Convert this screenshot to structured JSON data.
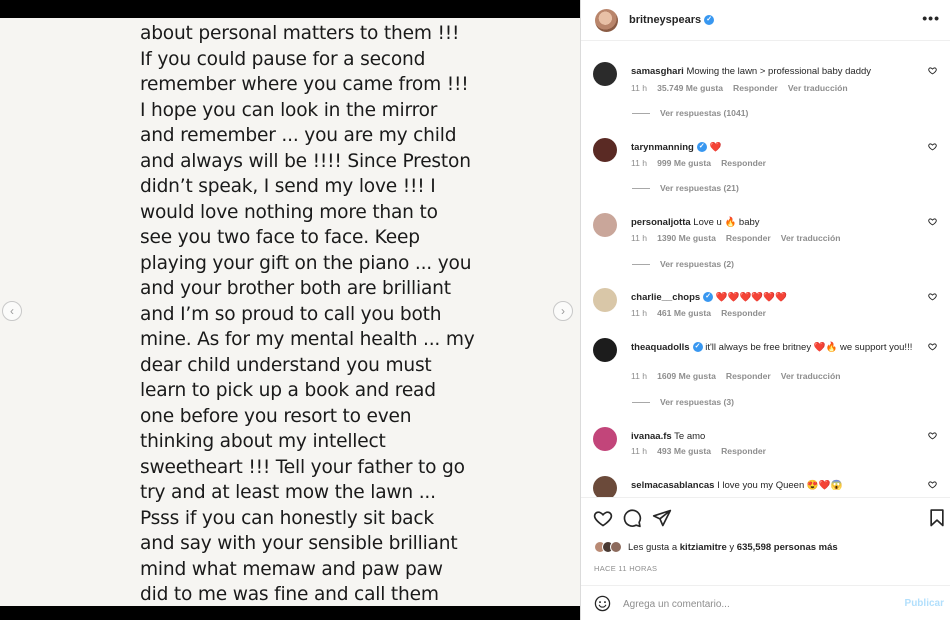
{
  "post_text_lines": [
    "about personal matters to them !!!",
    "If you could pause for a second",
    "remember where you came from !!!",
    "I hope you can look in the mirror",
    "and remember ... you are my child",
    "and always will be !!!! Since Preston",
    "didn’t speak, I send my love !!! I",
    "would love nothing more than to",
    "see you two face to face. Keep",
    "playing your gift on the piano ... you",
    "and your brother both are brilliant",
    "and I’m so proud to call you both",
    "mine. As for my mental health ... my",
    "dear child understand you must",
    "learn to pick up a book and read",
    "one before you resort to even",
    "thinking about my intellect",
    "sweetheart !!! Tell your father to go",
    "try and at least mow the lawn ...",
    "Psss if you can honestly sit back",
    "and say with your sensible brilliant",
    "mind what memaw and paw paw",
    "did to me was fine and call them"
  ],
  "nav": {
    "prev_icon": "chevron-left-icon",
    "next_icon": "chevron-right-icon",
    "prev_glyph": "‹",
    "next_glyph": "›"
  },
  "header": {
    "username": "britneyspears",
    "verified_glyph": "✓",
    "more_glyph": "•••"
  },
  "comments": [
    {
      "username": "samasghari",
      "verified": false,
      "text": "Mowing the lawn > professional baby daddy",
      "time": "11 h",
      "likes": "35.749 Me gusta",
      "reply": "Responder",
      "translate": "Ver traducción",
      "replies": "Ver respuestas (1041)",
      "avatar_color": "#2b2b2b"
    },
    {
      "username": "tarynmanning",
      "verified": true,
      "text": "❤️",
      "time": "11 h",
      "likes": "999 Me gusta",
      "reply": "Responder",
      "translate": "",
      "replies": "Ver respuestas (21)",
      "avatar_color": "#5a2a24"
    },
    {
      "username": "personaljotta",
      "verified": false,
      "text": "Love u 🔥 baby",
      "time": "11 h",
      "likes": "1390 Me gusta",
      "reply": "Responder",
      "translate": "Ver traducción",
      "replies": "Ver respuestas (2)",
      "avatar_color": "#c9a69a"
    },
    {
      "username": "charlie__chops",
      "verified": true,
      "text": "❤️❤️❤️❤️❤️❤️",
      "time": "11 h",
      "likes": "461 Me gusta",
      "reply": "Responder",
      "translate": "",
      "replies": "",
      "avatar_color": "#d9c7a8"
    },
    {
      "username": "theaquadolls",
      "verified": true,
      "text": "it'll always be free britney ❤️🔥 we support you!!!",
      "time": "11 h",
      "likes": "1609 Me gusta",
      "reply": "Responder",
      "translate": "Ver traducción",
      "replies": "Ver respuestas (3)",
      "avatar_color": "#1c1c1c"
    },
    {
      "username": "ivanaa.fs",
      "verified": false,
      "text": "Te amo",
      "time": "11 h",
      "likes": "493 Me gusta",
      "reply": "Responder",
      "translate": "",
      "replies": "",
      "avatar_color": "#c2457a"
    },
    {
      "username": "selmacasablancas",
      "verified": false,
      "text": "I love you my Queen 😍❤️😱",
      "time": "",
      "likes": "",
      "reply": "",
      "translate": "",
      "replies": "",
      "avatar_color": "#6b4a3a"
    }
  ],
  "actions": {
    "like_icon": "heart-outline-icon",
    "comment_icon": "speech-bubble-icon",
    "share_icon": "paper-plane-icon",
    "save_icon": "bookmark-icon"
  },
  "likes_summary": {
    "prefix": "Les gusta a",
    "user": "kitziamitre",
    "middle": "y",
    "count": "635,598 personas más"
  },
  "time_ago": "HACE 11 HORAS",
  "comment_box": {
    "placeholder": "Agrega un comentario...",
    "post_label": "Publicar"
  },
  "colors": {
    "accent": "#3897f0",
    "muted": "#8e8e8e",
    "publish_disabled": "#b2dffc",
    "heart_red": "#e0245e"
  }
}
